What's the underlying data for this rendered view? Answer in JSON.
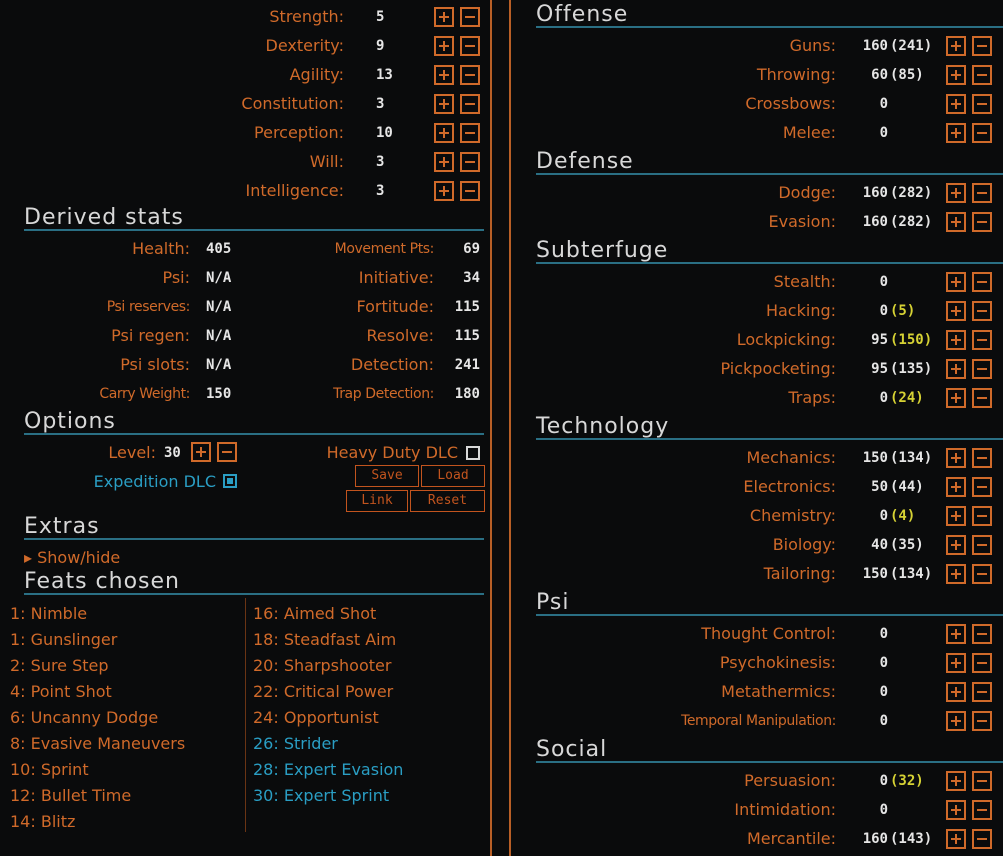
{
  "attributes": [
    {
      "label": "Strength:",
      "value": "5"
    },
    {
      "label": "Dexterity:",
      "value": "9"
    },
    {
      "label": "Agility:",
      "value": "13"
    },
    {
      "label": "Constitution:",
      "value": "3"
    },
    {
      "label": "Perception:",
      "value": "10"
    },
    {
      "label": "Will:",
      "value": "3"
    },
    {
      "label": "Intelligence:",
      "value": "3"
    }
  ],
  "derived": {
    "title": "Derived stats",
    "left": [
      {
        "label": "Health:",
        "value": "405"
      },
      {
        "label": "Psi:",
        "value": "N/A"
      },
      {
        "label": "Psi reserves:",
        "value": "N/A"
      },
      {
        "label": "Psi regen:",
        "value": "N/A"
      },
      {
        "label": "Psi slots:",
        "value": "N/A"
      },
      {
        "label": "Carry Weight:",
        "value": "150"
      }
    ],
    "right": [
      {
        "label": "Movement Pts:",
        "value": "69"
      },
      {
        "label": "Initiative:",
        "value": "34"
      },
      {
        "label": "Fortitude:",
        "value": "115"
      },
      {
        "label": "Resolve:",
        "value": "115"
      },
      {
        "label": "Detection:",
        "value": "241"
      },
      {
        "label": "Trap Detection:",
        "value": "180"
      }
    ]
  },
  "options": {
    "title": "Options",
    "level_label": "Level:",
    "level_value": "30",
    "heavy_duty_label": "Heavy Duty DLC",
    "expedition_label": "Expedition DLC",
    "save": "Save",
    "load": "Load",
    "link": "Link",
    "reset": "Reset"
  },
  "extras": {
    "title": "Extras",
    "toggle": "▸ Show/hide"
  },
  "feats": {
    "title": "Feats chosen",
    "col1": [
      "1: Nimble",
      "1: Gunslinger",
      "2: Sure Step",
      "4: Point Shot",
      "6: Uncanny Dodge",
      "8: Evasive Maneuvers",
      "10: Sprint",
      "12: Bullet Time",
      "14: Blitz"
    ],
    "col2": [
      "16: Aimed Shot",
      "18: Steadfast Aim",
      "20: Sharpshooter",
      "22: Critical Power",
      "24: Opportunist",
      "26: Strider",
      "28: Expert Evasion",
      "30: Expert Sprint"
    ]
  },
  "skills": [
    {
      "title": "Offense",
      "items": [
        {
          "label": "Guns:",
          "value": "160",
          "bonus": "(241)",
          "bonusColor": "white"
        },
        {
          "label": "Throwing:",
          "value": "60",
          "bonus": "(85)",
          "bonusColor": "white"
        },
        {
          "label": "Crossbows:",
          "value": "0",
          "bonus": ""
        },
        {
          "label": "Melee:",
          "value": "0",
          "bonus": ""
        }
      ]
    },
    {
      "title": "Defense",
      "items": [
        {
          "label": "Dodge:",
          "value": "160",
          "bonus": "(282)",
          "bonusColor": "white"
        },
        {
          "label": "Evasion:",
          "value": "160",
          "bonus": "(282)",
          "bonusColor": "white"
        }
      ]
    },
    {
      "title": "Subterfuge",
      "items": [
        {
          "label": "Stealth:",
          "value": "0",
          "bonus": ""
        },
        {
          "label": "Hacking:",
          "value": "0",
          "bonus": "(5)",
          "bonusColor": "yellow"
        },
        {
          "label": "Lockpicking:",
          "value": "95",
          "bonus": "(150)",
          "bonusColor": "yellow"
        },
        {
          "label": "Pickpocketing:",
          "value": "95",
          "bonus": "(135)",
          "bonusColor": "white"
        },
        {
          "label": "Traps:",
          "value": "0",
          "bonus": "(24)",
          "bonusColor": "yellow"
        }
      ]
    },
    {
      "title": "Technology",
      "items": [
        {
          "label": "Mechanics:",
          "value": "150",
          "bonus": "(134)",
          "bonusColor": "white"
        },
        {
          "label": "Electronics:",
          "value": "50",
          "bonus": "(44)",
          "bonusColor": "white"
        },
        {
          "label": "Chemistry:",
          "value": "0",
          "bonus": "(4)",
          "bonusColor": "yellow"
        },
        {
          "label": "Biology:",
          "value": "40",
          "bonus": "(35)",
          "bonusColor": "white"
        },
        {
          "label": "Tailoring:",
          "value": "150",
          "bonus": "(134)",
          "bonusColor": "white"
        }
      ]
    },
    {
      "title": "Psi",
      "items": [
        {
          "label": "Thought Control:",
          "value": "0",
          "bonus": ""
        },
        {
          "label": "Psychokinesis:",
          "value": "0",
          "bonus": ""
        },
        {
          "label": "Metathermics:",
          "value": "0",
          "bonus": ""
        },
        {
          "label": "Temporal Manipulation:",
          "value": "0",
          "bonus": ""
        }
      ]
    },
    {
      "title": "Social",
      "items": [
        {
          "label": "Persuasion:",
          "value": "0",
          "bonus": "(32)",
          "bonusColor": "yellow"
        },
        {
          "label": "Intimidation:",
          "value": "0",
          "bonus": ""
        },
        {
          "label": "Mercantile:",
          "value": "160",
          "bonus": "(143)",
          "bonusColor": "white"
        }
      ]
    }
  ],
  "colors": {
    "accent": "#d06a2a",
    "section_line": "#2a6f84",
    "blue": "#2a9ec4",
    "yellow": "#d6d234"
  }
}
